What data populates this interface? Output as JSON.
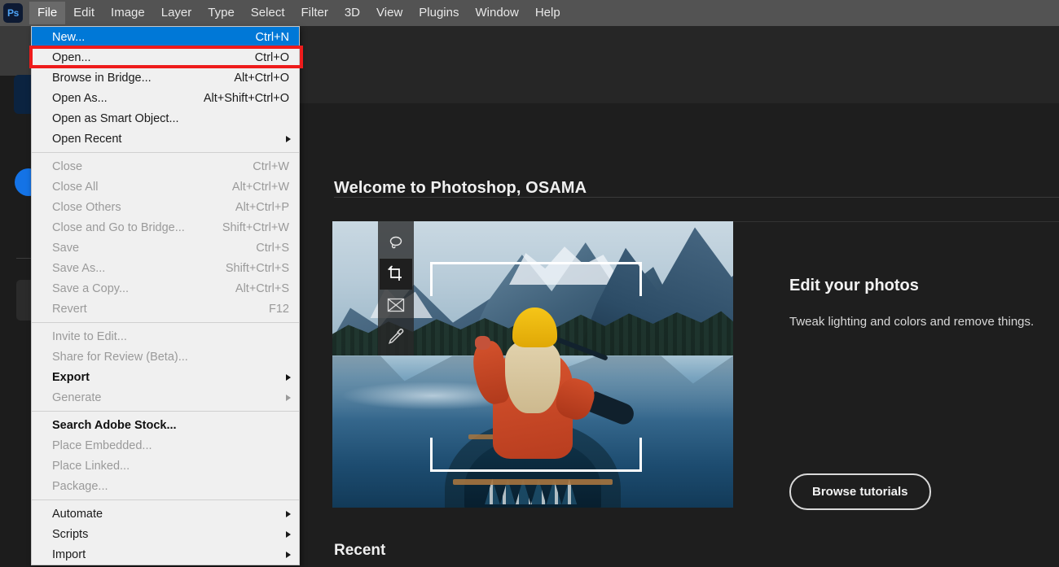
{
  "app": {
    "name": "Adobe Photoshop",
    "logo_text": "Ps",
    "accent_blue": "#1473e6",
    "menu_highlight": "#0078d7",
    "annotation_red": "#ee1b1b"
  },
  "menubar": {
    "items": [
      {
        "label": "File",
        "active": true
      },
      {
        "label": "Edit",
        "active": false
      },
      {
        "label": "Image",
        "active": false
      },
      {
        "label": "Layer",
        "active": false
      },
      {
        "label": "Type",
        "active": false
      },
      {
        "label": "Select",
        "active": false
      },
      {
        "label": "Filter",
        "active": false
      },
      {
        "label": "3D",
        "active": false
      },
      {
        "label": "View",
        "active": false
      },
      {
        "label": "Plugins",
        "active": false
      },
      {
        "label": "Window",
        "active": false
      },
      {
        "label": "Help",
        "active": false
      }
    ]
  },
  "file_menu": {
    "groups": [
      [
        {
          "label": "New...",
          "accel": "Ctrl+N",
          "state": "highlight",
          "submenu": false
        },
        {
          "label": "Open...",
          "accel": "Ctrl+O",
          "state": "enabled",
          "submenu": false
        },
        {
          "label": "Browse in Bridge...",
          "accel": "Alt+Ctrl+O",
          "state": "enabled",
          "submenu": false
        },
        {
          "label": "Open As...",
          "accel": "Alt+Shift+Ctrl+O",
          "state": "enabled",
          "submenu": false
        },
        {
          "label": "Open as Smart Object...",
          "accel": "",
          "state": "enabled",
          "submenu": false
        },
        {
          "label": "Open Recent",
          "accel": "",
          "state": "enabled",
          "submenu": true
        }
      ],
      [
        {
          "label": "Close",
          "accel": "Ctrl+W",
          "state": "disabled",
          "submenu": false
        },
        {
          "label": "Close All",
          "accel": "Alt+Ctrl+W",
          "state": "disabled",
          "submenu": false
        },
        {
          "label": "Close Others",
          "accel": "Alt+Ctrl+P",
          "state": "disabled",
          "submenu": false
        },
        {
          "label": "Close and Go to Bridge...",
          "accel": "Shift+Ctrl+W",
          "state": "disabled",
          "submenu": false
        },
        {
          "label": "Save",
          "accel": "Ctrl+S",
          "state": "disabled",
          "submenu": false
        },
        {
          "label": "Save As...",
          "accel": "Shift+Ctrl+S",
          "state": "disabled",
          "submenu": false
        },
        {
          "label": "Save a Copy...",
          "accel": "Alt+Ctrl+S",
          "state": "disabled",
          "submenu": false
        },
        {
          "label": "Revert",
          "accel": "F12",
          "state": "disabled",
          "submenu": false
        }
      ],
      [
        {
          "label": "Invite to Edit...",
          "accel": "",
          "state": "disabled",
          "submenu": false
        },
        {
          "label": "Share for Review (Beta)...",
          "accel": "",
          "state": "disabled",
          "submenu": false
        },
        {
          "label": "Export",
          "accel": "",
          "state": "strong",
          "submenu": true
        },
        {
          "label": "Generate",
          "accel": "",
          "state": "disabled",
          "submenu": true
        }
      ],
      [
        {
          "label": "Search Adobe Stock...",
          "accel": "",
          "state": "strong",
          "submenu": false
        },
        {
          "label": "Place Embedded...",
          "accel": "",
          "state": "disabled",
          "submenu": false
        },
        {
          "label": "Place Linked...",
          "accel": "",
          "state": "disabled",
          "submenu": false
        },
        {
          "label": "Package...",
          "accel": "",
          "state": "disabled",
          "submenu": false
        }
      ],
      [
        {
          "label": "Automate",
          "accel": "",
          "state": "enabled",
          "submenu": true
        },
        {
          "label": "Scripts",
          "accel": "",
          "state": "enabled",
          "submenu": true
        },
        {
          "label": "Import",
          "accel": "",
          "state": "enabled",
          "submenu": true
        }
      ]
    ]
  },
  "home_screen": {
    "welcome_title": "Welcome to Photoshop, OSAMA",
    "recent_title": "Recent",
    "hero": {
      "heading": "Edit your photos",
      "description": "Tweak lighting and colors and remove things.",
      "button_label": "Browse tutorials",
      "image_alt": "Woman in orange sweater and yellow beanie paddling a canoe on a mountain lake",
      "tools": [
        {
          "name": "lasso-tool",
          "selected": false
        },
        {
          "name": "crop-tool",
          "selected": true
        },
        {
          "name": "frame-tool",
          "selected": false
        },
        {
          "name": "eyedropper-tool",
          "selected": false
        }
      ]
    }
  }
}
